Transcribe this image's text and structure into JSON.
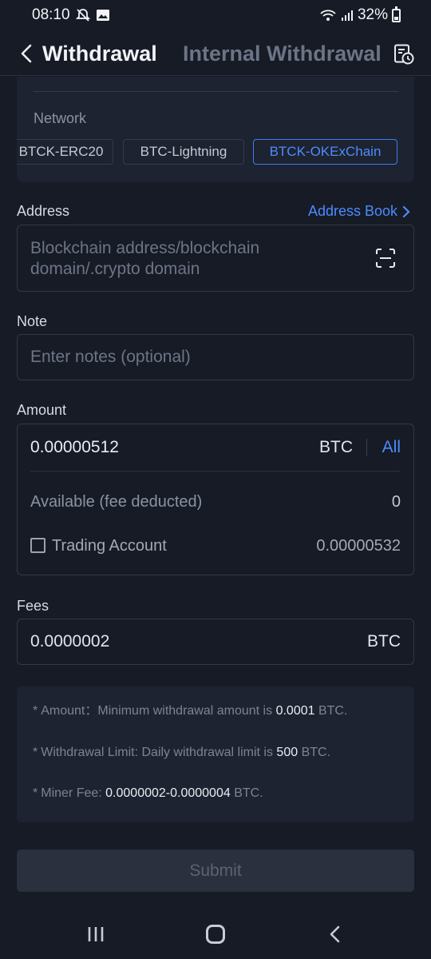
{
  "status_bar": {
    "time": "08:10",
    "battery": "32%"
  },
  "header": {
    "title": "Withdrawal",
    "tab_internal": "Internal Withdrawal"
  },
  "network": {
    "label": "Network",
    "chips": [
      {
        "label": "BTCK-ERC20",
        "selected": false
      },
      {
        "label": "BTC-Lightning",
        "selected": false
      },
      {
        "label": "BTCK-OKExChain",
        "selected": true
      }
    ]
  },
  "address": {
    "label": "Address",
    "address_book_link": "Address Book",
    "placeholder": "Blockchain address/blockchain domain/.crypto domain"
  },
  "note": {
    "label": "Note",
    "placeholder": "Enter notes (optional)"
  },
  "amount": {
    "label": "Amount",
    "value": "0.00000512",
    "unit": "BTC",
    "all_label": "All",
    "available_label": "Available (fee deducted)",
    "available_value": "0",
    "trading_account_label": "Trading Account",
    "trading_account_value": "0.00000532"
  },
  "fees": {
    "label": "Fees",
    "value": "0.0000002",
    "unit": "BTC"
  },
  "info": {
    "line1_prefix": "Amount：Minimum withdrawal amount is",
    "line1_value": "0.0001",
    "line1_suffix": "BTC.",
    "line2_prefix": "Withdrawal Limit: Daily withdrawal limit is",
    "line2_value": "500",
    "line2_suffix": "BTC.",
    "line3_prefix": "Miner Fee:",
    "line3_value": "0.0000002-0.0000004",
    "line3_suffix": "BTC."
  },
  "submit_label": "Submit",
  "colors": {
    "background": "#161b26",
    "accent": "#4d8bff",
    "card": "#1d2330"
  }
}
